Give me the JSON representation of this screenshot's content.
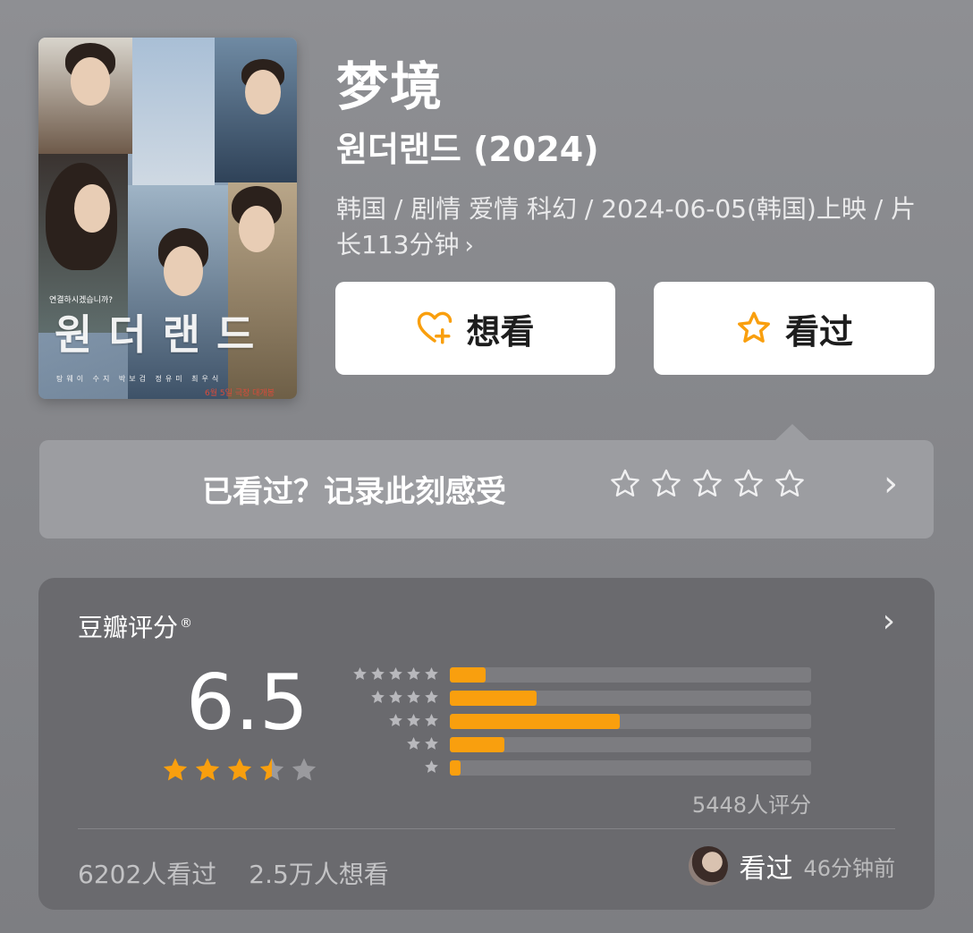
{
  "movie": {
    "title_cn": "梦境",
    "title_original": "원더랜드 (2024)",
    "meta": "韩国 / 剧情 爱情 科幻 / 2024-06-05(韩国)上映 / 片长113分钟",
    "meta_chevron": "›"
  },
  "poster": {
    "title": "원더랜드",
    "tagline": "연결하시겠습니까?",
    "credits": "탕웨이 수지 박보검 정유미 최우식",
    "release": "6월 5일 극장 대개봉"
  },
  "actions": {
    "want_label": "想看",
    "seen_label": "看过"
  },
  "record": {
    "prompt": "已看过？记录此刻感受",
    "chevron": "›"
  },
  "rating": {
    "label": "豆瓣评分",
    "registered": "®",
    "chevron": "›",
    "score": "6.5",
    "score_stars": 3.5,
    "distribution": [
      {
        "stars": 5,
        "percent": 10
      },
      {
        "stars": 4,
        "percent": 24
      },
      {
        "stars": 3,
        "percent": 47
      },
      {
        "stars": 2,
        "percent": 15
      },
      {
        "stars": 1,
        "percent": 3
      }
    ],
    "count_text": "5448人评分"
  },
  "stats": {
    "seen": "6202人看过",
    "want": "2.5万人想看"
  },
  "recent": {
    "action": "看过",
    "time": "46分钟前"
  },
  "colors": {
    "accent": "#f99f0e",
    "card": "#6a6a6e",
    "record_bg": "#9c9da1"
  }
}
